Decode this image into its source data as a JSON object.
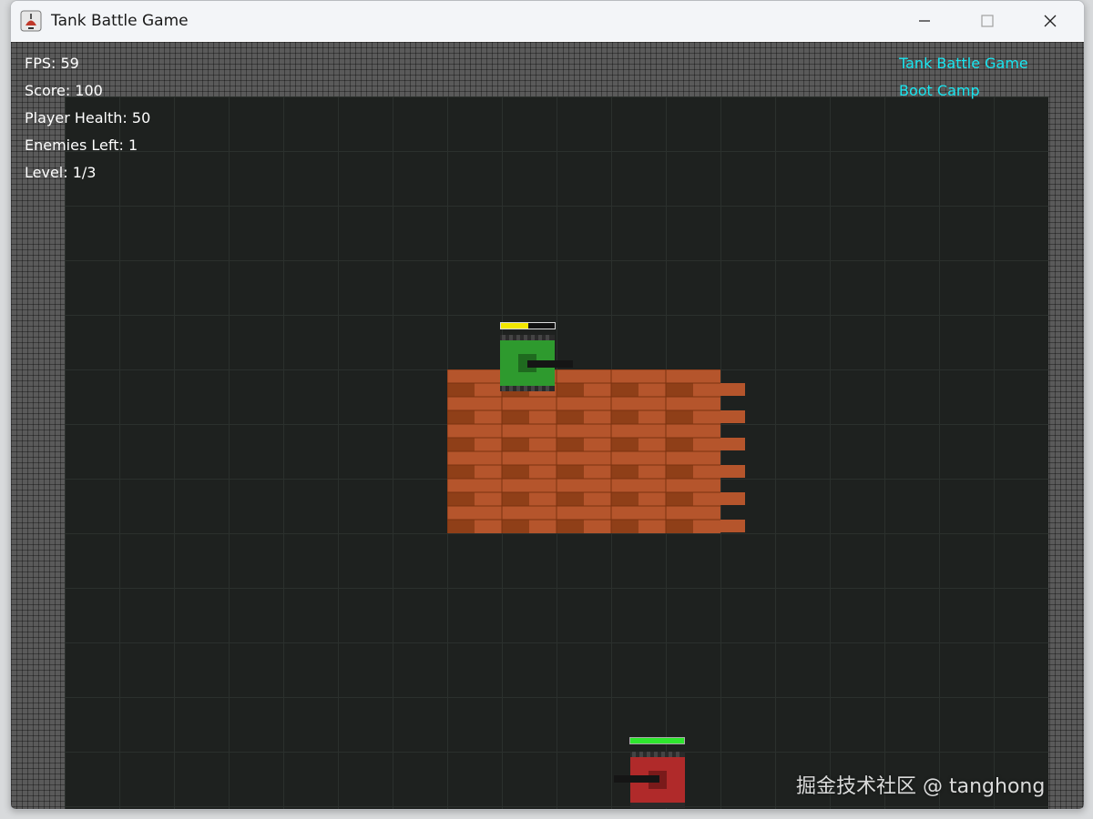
{
  "window": {
    "title": "Tank Battle Game"
  },
  "hud": {
    "fps": "FPS: 59",
    "score": "Score: 100",
    "health": "Player Health: 50",
    "enemies": "Enemies Left: 1",
    "level": "Level: 1/3"
  },
  "banner": {
    "line1": "Tank Battle Game",
    "line2": "Boot Camp"
  },
  "player_tank": {
    "color": "#2e9a2e",
    "health_fraction": 0.5,
    "health_bar_color": "#f2e600"
  },
  "enemy_tank": {
    "color": "#b02a2a",
    "health_fraction": 1.0,
    "health_bar_color": "#2ee62e"
  },
  "colors": {
    "hud_text": "#ffffff",
    "banner_text": "#19e6f0",
    "brick": "#b5552c",
    "brick_dark": "#8f3f18"
  },
  "watermark": "掘金技术社区 @ tanghong"
}
